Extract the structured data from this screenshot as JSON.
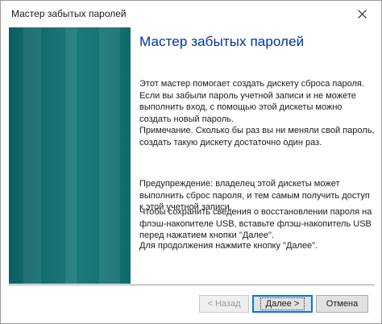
{
  "window": {
    "title": "Мастер забытых паролей"
  },
  "wizard": {
    "heading": "Мастер забытых паролей",
    "paragraphs": {
      "intro": "Этот мастер помогает создать дискету сброса пароля. Если вы забыли пароль учетной записи и не можете выполнить вход, с помощью этой дискеты можно создать новый пароль.",
      "note": "Примечание. Сколько бы раз вы ни меняли свой пароль, создать такую дискету достаточно один раз.",
      "warning": "Предупреждение: владелец этой дискеты может выполнить сброс пароля, и тем самым получить доступ к этой учетной записи.",
      "usb": "Чтобы сохранить сведения о восстановлении пароля на флэш-накопителе USB, вставьте флэш-накопитель USB перед нажатием кнопки \"Далее\".",
      "continue": "Для продолжения нажмите кнопку \"Далее\"."
    }
  },
  "buttons": {
    "back": "< Назад",
    "next": "Далее >",
    "cancel": "Отмена"
  },
  "colors": {
    "heading": "#003399",
    "sidebar": "#1c7a7a",
    "focus_border": "#0078d7"
  },
  "icons": {
    "close": "close-icon"
  }
}
